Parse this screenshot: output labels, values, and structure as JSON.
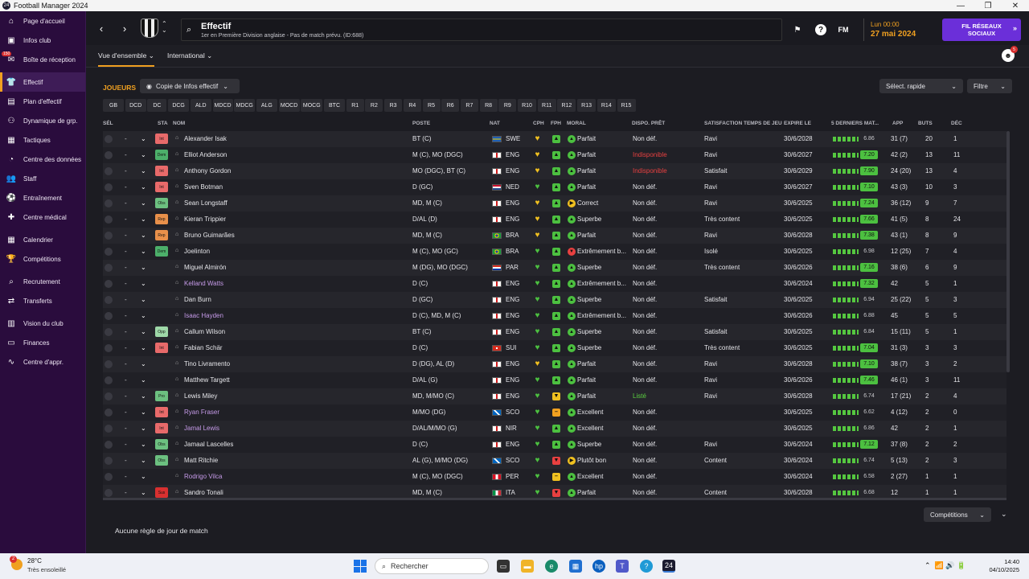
{
  "window": {
    "title": "Football Manager 2024"
  },
  "sidebar": {
    "items": [
      {
        "label": "Page d'accueil",
        "icon": "home-icon",
        "glyph": "⌂"
      },
      {
        "label": "Infos club",
        "icon": "club-icon",
        "glyph": "▣"
      },
      {
        "label": "Boîte de réception",
        "icon": "inbox-icon",
        "glyph": "✉",
        "badge": "150"
      },
      {
        "label": "Effectif",
        "icon": "shirt-icon",
        "glyph": "👕",
        "active": true
      },
      {
        "label": "Plan d'effectif",
        "icon": "plan-icon",
        "glyph": "▤"
      },
      {
        "label": "Dynamique de grp.",
        "icon": "dynamics-icon",
        "glyph": "⚇"
      },
      {
        "label": "Tactiques",
        "icon": "tactics-icon",
        "glyph": "▦"
      },
      {
        "label": "Centre des données",
        "icon": "data-icon",
        "glyph": "◔"
      },
      {
        "label": "Staff",
        "icon": "staff-icon",
        "glyph": "👥"
      },
      {
        "label": "Entraînement",
        "icon": "training-icon",
        "glyph": "⚽"
      },
      {
        "label": "Centre médical",
        "icon": "medical-icon",
        "glyph": "✚"
      },
      {
        "label": "Calendrier",
        "icon": "calendar-icon",
        "glyph": "▦"
      },
      {
        "label": "Compétitions",
        "icon": "trophy-icon",
        "glyph": "🏆"
      },
      {
        "label": "Recrutement",
        "icon": "scouting-icon",
        "glyph": "⌕"
      },
      {
        "label": "Transferts",
        "icon": "transfers-icon",
        "glyph": "⇄"
      },
      {
        "label": "Vision du club",
        "icon": "vision-icon",
        "glyph": "▥"
      },
      {
        "label": "Finances",
        "icon": "finances-icon",
        "glyph": "▭"
      },
      {
        "label": "Centre d'appr.",
        "icon": "learning-icon",
        "glyph": "∿"
      }
    ]
  },
  "header": {
    "title": "Effectif",
    "subtitle": "1er en Première Division anglaise - Pas de match prévu. (ID:688)",
    "fm_label": "FM",
    "date_line1": "Lun 00:00",
    "date_line2": "27 mai 2024",
    "social_label": "FIL RÉSEAUX SOCIAUX"
  },
  "subnav": {
    "tab1": "Vue d'ensemble",
    "tab2": "International",
    "avatar_badge": "5"
  },
  "toolbar": {
    "section_title": "JOUEURS",
    "view_dropdown": "Copie de Infos effectif",
    "quick_select": "Sélect. rapide",
    "filter": "Filtre"
  },
  "positions": [
    "GB",
    "DCD",
    "DC",
    "DCG",
    "ALD",
    "MDCD",
    "MDCG",
    "ALG",
    "MOCD",
    "MOCG",
    "BTC",
    "R1",
    "R2",
    "R3",
    "R4",
    "R5",
    "R6",
    "R7",
    "R8",
    "R9",
    "R10",
    "R11",
    "R12",
    "R13",
    "R14",
    "R15"
  ],
  "columns": {
    "sel": "SÉL",
    "sta": "STA",
    "nom": "NOM",
    "poste": "POSTE",
    "nat": "NAT",
    "cph": "CPH",
    "fph": "FPH",
    "moral": "MORAL",
    "dispo": "DISPO. PRÊT",
    "satisf": "SATISFACTION TEMPS DE JEU",
    "expire": "EXPIRE LE",
    "form": "5 DERNIERS MAT...",
    "app": "APP",
    "buts": "BUTS",
    "dec": "DÉC"
  },
  "players": [
    {
      "sta": "Int",
      "sta_color": "#e86a6a",
      "name": "Alexander Isak",
      "poste": "BT (C)",
      "nat": "SWE",
      "flag": "linear-gradient(#1e5fb5 0 40%,#f5d000 40% 60%,#1e5fb5 60%)",
      "cph": "#f0c020",
      "fph": "▲",
      "fph_color": "#4cc040",
      "mood": "▲",
      "mood_color": "#4cc040",
      "moral": "Parfait",
      "dispo": "Non déf.",
      "sat": "Ravi",
      "expire": "30/6/2028",
      "rating": "6.86",
      "hl": false,
      "app": "31 (7)",
      "buts": "20",
      "dec": "1"
    },
    {
      "sta": "Dem",
      "sta_color": "#4caf6a",
      "name": "Elliot Anderson",
      "poste": "M (C), MO (DGC)",
      "nat": "ENG",
      "flag": "linear-gradient(90deg,#fff 0 42%,#d01c1c 42% 58%,#fff 58%)",
      "cph": "#f0c020",
      "fph": "▲",
      "fph_color": "#4cc040",
      "mood": "▲",
      "mood_color": "#4cc040",
      "moral": "Parfait",
      "dispo": "Indisponible",
      "dispo_red": true,
      "sat": "Ravi",
      "expire": "30/6/2027",
      "rating": "7.20",
      "hl": true,
      "app": "42 (2)",
      "buts": "13",
      "dec": "11"
    },
    {
      "sta": "Int",
      "sta_color": "#e86a6a",
      "name": "Anthony Gordon",
      "poste": "MO (DGC), BT (C)",
      "nat": "ENG",
      "flag": "linear-gradient(90deg,#fff 0 42%,#d01c1c 42% 58%,#fff 58%)",
      "cph": "#f0c020",
      "fph": "▲",
      "fph_color": "#4cc040",
      "mood": "▲",
      "mood_color": "#4cc040",
      "moral": "Parfait",
      "dispo": "Indisponible",
      "dispo_red": true,
      "sat": "Satisfait",
      "expire": "30/6/2029",
      "rating": "7.90",
      "hl": true,
      "app": "24 (20)",
      "buts": "13",
      "dec": "4"
    },
    {
      "sta": "Int",
      "sta_color": "#e86a6a",
      "name": "Sven Botman",
      "poste": "D (GC)",
      "nat": "NED",
      "flag": "linear-gradient(#c8102e 0 33%,#fff 33% 66%,#21468b 66%)",
      "cph": "#4cc040",
      "fph": "▲",
      "fph_color": "#4cc040",
      "mood": "▲",
      "mood_color": "#4cc040",
      "moral": "Parfait",
      "dispo": "Non déf.",
      "sat": "Ravi",
      "expire": "30/6/2027",
      "rating": "7.10",
      "hl": true,
      "app": "43 (3)",
      "buts": "10",
      "dec": "3"
    },
    {
      "sta": "Obs",
      "sta_color": "#6cc080",
      "name": "Sean Longstaff",
      "poste": "MD, M (C)",
      "nat": "ENG",
      "flag": "linear-gradient(90deg,#fff 0 42%,#d01c1c 42% 58%,#fff 58%)",
      "cph": "#f0c020",
      "fph": "▲",
      "fph_color": "#4cc040",
      "mood": "▶",
      "mood_color": "#f0c020",
      "moral": "Correct",
      "dispo": "Non déf.",
      "sat": "Ravi",
      "expire": "30/6/2025",
      "rating": "7.24",
      "hl": true,
      "app": "36 (12)",
      "buts": "9",
      "dec": "7"
    },
    {
      "sta": "Rep",
      "sta_color": "#e8904a",
      "name": "Kieran Trippier",
      "poste": "D/AL (D)",
      "nat": "ENG",
      "flag": "linear-gradient(90deg,#fff 0 42%,#d01c1c 42% 58%,#fff 58%)",
      "cph": "#f0c020",
      "fph": "▲",
      "fph_color": "#4cc040",
      "mood": "▲",
      "mood_color": "#4cc040",
      "moral": "Superbe",
      "dispo": "Non déf.",
      "sat": "Très content",
      "expire": "30/6/2025",
      "rating": "7.66",
      "hl": true,
      "app": "41 (5)",
      "buts": "8",
      "dec": "24"
    },
    {
      "sta": "Rep",
      "sta_color": "#e8904a",
      "name": "Bruno Guimarães",
      "poste": "MD, M (C)",
      "nat": "BRA",
      "flag": "radial-gradient(circle,#2040a0 0 25%,#f5d000 26% 45%,#1a9a3a 46%)",
      "cph": "#f0c020",
      "fph": "▲",
      "fph_color": "#4cc040",
      "mood": "▲",
      "mood_color": "#4cc040",
      "moral": "Parfait",
      "dispo": "Non déf.",
      "sat": "Ravi",
      "expire": "30/6/2028",
      "rating": "7.38",
      "hl": true,
      "app": "43 (1)",
      "buts": "8",
      "dec": "9"
    },
    {
      "sta": "Dem",
      "sta_color": "#4caf6a",
      "name": "Joelinton",
      "poste": "M (C), MO (GC)",
      "nat": "BRA",
      "flag": "radial-gradient(circle,#2040a0 0 25%,#f5d000 26% 45%,#1a9a3a 46%)",
      "cph": "#4cc040",
      "fph": "▲",
      "fph_color": "#4cc040",
      "mood": "▼",
      "mood_color": "#e84040",
      "moral": "Extrêmement b...",
      "dispo": "Non déf.",
      "sat": "Isolé",
      "expire": "30/6/2025",
      "rating": "6.98",
      "hl": false,
      "app": "12 (25)",
      "buts": "7",
      "dec": "4"
    },
    {
      "sta": "",
      "sta_color": "",
      "name": "Miguel Almirón",
      "poste": "M (DG), MO (DGC)",
      "nat": "PAR",
      "flag": "linear-gradient(#d52b1e 0 33%,#fff 33% 66%,#0038a8 66%)",
      "cph": "#4cc040",
      "fph": "▲",
      "fph_color": "#4cc040",
      "mood": "▲",
      "mood_color": "#4cc040",
      "moral": "Superbe",
      "dispo": "Non déf.",
      "sat": "Très content",
      "expire": "30/6/2026",
      "rating": "7.16",
      "hl": true,
      "app": "38 (6)",
      "buts": "6",
      "dec": "9"
    },
    {
      "sta": "",
      "sta_color": "",
      "name": "Kelland Watts",
      "lilac": true,
      "poste": "D (C)",
      "nat": "ENG",
      "flag": "linear-gradient(90deg,#fff 0 42%,#d01c1c 42% 58%,#fff 58%)",
      "cph": "#4cc040",
      "fph": "▲",
      "fph_color": "#4cc040",
      "mood": "▲",
      "mood_color": "#4cc040",
      "moral": "Extrêmement b...",
      "dispo": "Non déf.",
      "sat": "",
      "expire": "30/6/2024",
      "rating": "7.32",
      "hl": true,
      "app": "42",
      "buts": "5",
      "dec": "1"
    },
    {
      "sta": "",
      "sta_color": "",
      "name": "Dan Burn",
      "poste": "D (GC)",
      "nat": "ENG",
      "flag": "linear-gradient(90deg,#fff 0 42%,#d01c1c 42% 58%,#fff 58%)",
      "cph": "#4cc040",
      "fph": "▲",
      "fph_color": "#4cc040",
      "mood": "▲",
      "mood_color": "#4cc040",
      "moral": "Superbe",
      "dispo": "Non déf.",
      "sat": "Satisfait",
      "expire": "30/6/2025",
      "rating": "6.94",
      "hl": false,
      "app": "25 (22)",
      "buts": "5",
      "dec": "3"
    },
    {
      "sta": "",
      "sta_color": "",
      "name": "Isaac Hayden",
      "lilac": true,
      "poste": "D (C), MD, M (C)",
      "nat": "ENG",
      "flag": "linear-gradient(90deg,#fff 0 42%,#d01c1c 42% 58%,#fff 58%)",
      "cph": "#4cc040",
      "fph": "▲",
      "fph_color": "#4cc040",
      "mood": "▲",
      "mood_color": "#4cc040",
      "moral": "Extrêmement b...",
      "dispo": "Non déf.",
      "sat": "",
      "expire": "30/6/2026",
      "rating": "6.88",
      "hl": false,
      "app": "45",
      "buts": "5",
      "dec": "5"
    },
    {
      "sta": "Opp",
      "sta_color": "#9ed8a8",
      "name": "Callum Wilson",
      "poste": "BT (C)",
      "nat": "ENG",
      "flag": "linear-gradient(90deg,#fff 0 42%,#d01c1c 42% 58%,#fff 58%)",
      "cph": "#4cc040",
      "fph": "▲",
      "fph_color": "#4cc040",
      "mood": "▲",
      "mood_color": "#4cc040",
      "moral": "Superbe",
      "dispo": "Non déf.",
      "sat": "Satisfait",
      "expire": "30/6/2025",
      "rating": "6.84",
      "hl": false,
      "app": "15 (11)",
      "buts": "5",
      "dec": "1"
    },
    {
      "sta": "Int",
      "sta_color": "#e86a6a",
      "name": "Fabian Schär",
      "poste": "D (C)",
      "nat": "SUI",
      "flag": "radial-gradient(circle,#fff 0 20%,#d52b1e 22%)",
      "cph": "#4cc040",
      "fph": "▲",
      "fph_color": "#4cc040",
      "mood": "▲",
      "mood_color": "#4cc040",
      "moral": "Superbe",
      "dispo": "Non déf.",
      "sat": "Très content",
      "expire": "30/6/2025",
      "rating": "7.04",
      "hl": true,
      "app": "31 (3)",
      "buts": "3",
      "dec": "3"
    },
    {
      "sta": "",
      "sta_color": "",
      "name": "Tino Livramento",
      "poste": "D (DG), AL (D)",
      "nat": "ENG",
      "flag": "linear-gradient(90deg,#fff 0 42%,#d01c1c 42% 58%,#fff 58%)",
      "cph": "#f0c020",
      "fph": "▲",
      "fph_color": "#4cc040",
      "mood": "▲",
      "mood_color": "#4cc040",
      "moral": "Parfait",
      "dispo": "Non déf.",
      "sat": "Ravi",
      "expire": "30/6/2028",
      "rating": "7.10",
      "hl": true,
      "app": "38 (7)",
      "buts": "3",
      "dec": "2"
    },
    {
      "sta": "",
      "sta_color": "",
      "name": "Matthew Targett",
      "poste": "D/AL (G)",
      "nat": "ENG",
      "flag": "linear-gradient(90deg,#fff 0 42%,#d01c1c 42% 58%,#fff 58%)",
      "cph": "#4cc040",
      "fph": "▲",
      "fph_color": "#4cc040",
      "mood": "▲",
      "mood_color": "#4cc040",
      "moral": "Parfait",
      "dispo": "Non déf.",
      "sat": "Ravi",
      "expire": "30/6/2026",
      "rating": "7.46",
      "hl": true,
      "app": "46 (1)",
      "buts": "3",
      "dec": "11"
    },
    {
      "sta": "Pro",
      "sta_color": "#6cc080",
      "name": "Lewis Miley",
      "poste": "MD, M/MO (C)",
      "nat": "ENG",
      "flag": "linear-gradient(90deg,#fff 0 42%,#d01c1c 42% 58%,#fff 58%)",
      "cph": "#4cc040",
      "fph": "▼",
      "fph_color": "#f0c020",
      "mood": "▲",
      "mood_color": "#4cc040",
      "moral": "Parfait",
      "dispo": "Listé",
      "dispo_green": true,
      "sat": "Ravi",
      "expire": "30/6/2028",
      "rating": "6.74",
      "hl": false,
      "app": "17 (21)",
      "buts": "2",
      "dec": "4"
    },
    {
      "sta": "Int",
      "sta_color": "#e86a6a",
      "name": "Ryan Fraser",
      "lilac": true,
      "poste": "M/MO (DG)",
      "nat": "SCO",
      "flag": "linear-gradient(45deg,#0065bf 0 42%,#fff 42% 58%,#0065bf 58%)",
      "cph": "#4cc040",
      "fph": "–",
      "fph_color": "#f0a020",
      "mood": "▲",
      "mood_color": "#4cc040",
      "moral": "Excellent",
      "dispo": "Non déf.",
      "sat": "",
      "expire": "30/6/2025",
      "rating": "6.62",
      "hl": false,
      "app": "4 (12)",
      "buts": "2",
      "dec": "0"
    },
    {
      "sta": "Int",
      "sta_color": "#e86a6a",
      "name": "Jamal Lewis",
      "lilac": true,
      "poste": "D/AL/M/MO (G)",
      "nat": "NIR",
      "flag": "linear-gradient(90deg,#fff 0 42%,#d01c1c 42% 58%,#fff 58%)",
      "cph": "#4cc040",
      "fph": "▲",
      "fph_color": "#4cc040",
      "mood": "▲",
      "mood_color": "#4cc040",
      "moral": "Excellent",
      "dispo": "Non déf.",
      "sat": "",
      "expire": "30/6/2025",
      "rating": "6.86",
      "hl": false,
      "app": "42",
      "buts": "2",
      "dec": "1"
    },
    {
      "sta": "Obs",
      "sta_color": "#6cc080",
      "name": "Jamaal Lascelles",
      "poste": "D (C)",
      "nat": "ENG",
      "flag": "linear-gradient(90deg,#fff 0 42%,#d01c1c 42% 58%,#fff 58%)",
      "cph": "#4cc040",
      "fph": "▲",
      "fph_color": "#4cc040",
      "mood": "▲",
      "mood_color": "#4cc040",
      "moral": "Superbe",
      "dispo": "Non déf.",
      "sat": "Ravi",
      "expire": "30/6/2024",
      "rating": "7.12",
      "hl": true,
      "app": "37 (8)",
      "buts": "2",
      "dec": "2"
    },
    {
      "sta": "Obs",
      "sta_color": "#6cc080",
      "name": "Matt Ritchie",
      "poste": "AL (G), M/MO (DG)",
      "nat": "SCO",
      "flag": "linear-gradient(45deg,#0065bf 0 42%,#fff 42% 58%,#0065bf 58%)",
      "cph": "#4cc040",
      "fph": "▼",
      "fph_color": "#e84040",
      "mood": "▶",
      "mood_color": "#f0c020",
      "moral": "Plutôt bon",
      "dispo": "Non déf.",
      "sat": "Content",
      "expire": "30/6/2024",
      "rating": "6.74",
      "hl": false,
      "app": "5 (13)",
      "buts": "2",
      "dec": "3"
    },
    {
      "sta": "",
      "sta_color": "",
      "name": "Rodrigo Vilca",
      "lilac": true,
      "poste": "M (C), MO (DGC)",
      "nat": "PER",
      "flag": "linear-gradient(90deg,#d91023 0 33%,#fff 33% 66%,#d91023 66%)",
      "cph": "#4cc040",
      "fph": "–",
      "fph_color": "#f0c020",
      "mood": "▲",
      "mood_color": "#4cc040",
      "moral": "Excellent",
      "dispo": "Non déf.",
      "sat": "",
      "expire": "30/6/2024",
      "rating": "6.58",
      "hl": false,
      "app": "2 (27)",
      "buts": "1",
      "dec": "1"
    },
    {
      "sta": "Sus",
      "sta_color": "#d83030",
      "name": "Sandro Tonali",
      "poste": "MD, M (C)",
      "nat": "ITA",
      "flag": "linear-gradient(90deg,#009246 0 33%,#fff 33% 66%,#ce2b37 66%)",
      "cph": "#4cc040",
      "fph": "▼",
      "fph_color": "#e84040",
      "mood": "▲",
      "mood_color": "#4cc040",
      "moral": "Parfait",
      "dispo": "Non déf.",
      "sat": "Content",
      "expire": "30/6/2028",
      "rating": "6.68",
      "hl": false,
      "app": "12",
      "buts": "1",
      "dec": "1"
    }
  ],
  "footer": {
    "competitions_btn": "Compétitions",
    "matchday_rules": "Aucune règle de jour de match"
  },
  "taskbar": {
    "temp": "28°C",
    "weather": "Très ensoleillé",
    "weather_badge": "2",
    "search": "Rechercher",
    "time": "14:40",
    "date": "04/10/2025"
  },
  "colors": {
    "sidebar": "#2a0c3d",
    "accent": "#f0a020",
    "social": "#6b2fd9"
  }
}
